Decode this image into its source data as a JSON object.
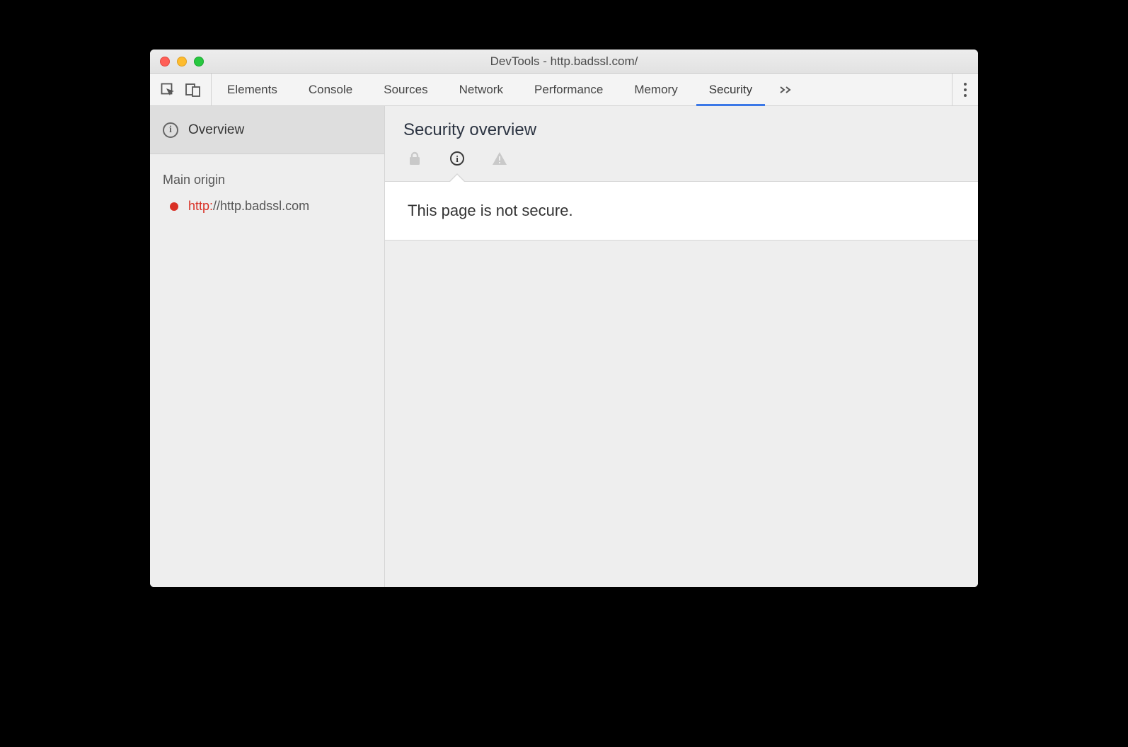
{
  "window": {
    "title": "DevTools - http.badssl.com/"
  },
  "toolbar": {
    "tabs": [
      {
        "label": "Elements",
        "active": false
      },
      {
        "label": "Console",
        "active": false
      },
      {
        "label": "Sources",
        "active": false
      },
      {
        "label": "Network",
        "active": false
      },
      {
        "label": "Performance",
        "active": false
      },
      {
        "label": "Memory",
        "active": false
      },
      {
        "label": "Security",
        "active": true
      }
    ]
  },
  "sidebar": {
    "overview_label": "Overview",
    "section_label": "Main origin",
    "origin": {
      "scheme": "http:",
      "rest": "//http.badssl.com"
    }
  },
  "main": {
    "title": "Security overview",
    "message": "This page is not secure."
  }
}
